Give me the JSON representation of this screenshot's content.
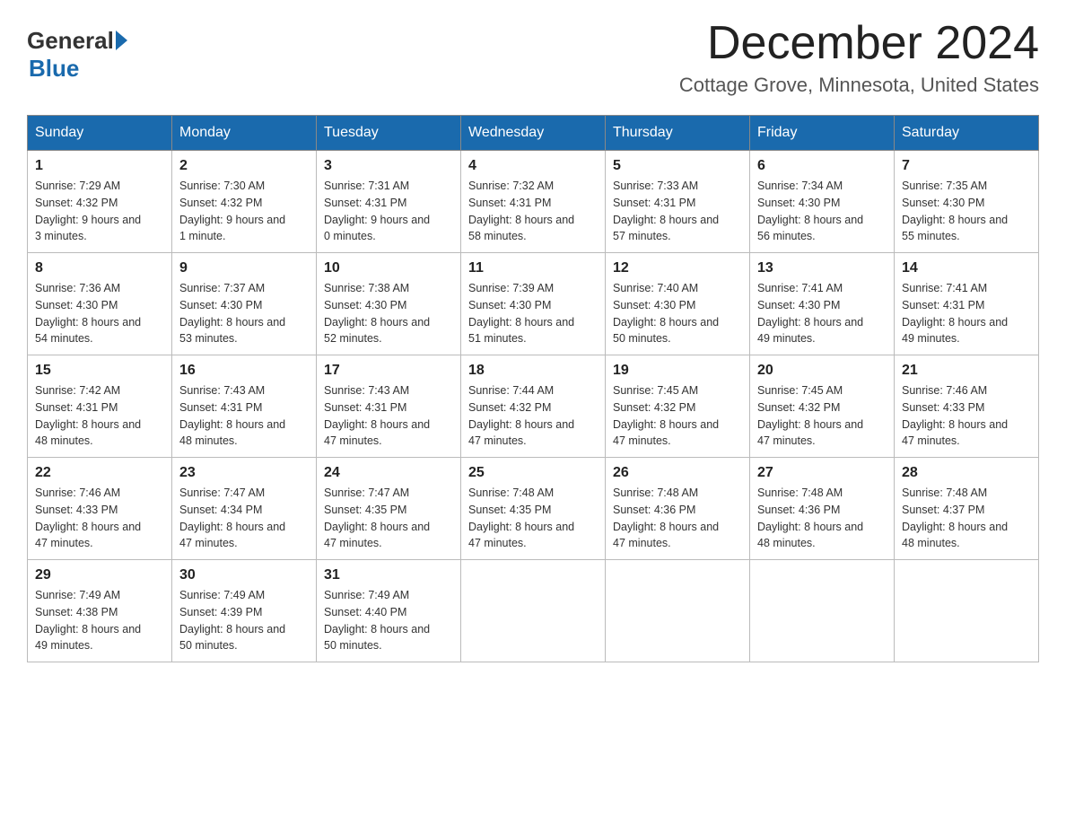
{
  "header": {
    "logo_general": "General",
    "logo_blue": "Blue",
    "month_title": "December 2024",
    "location": "Cottage Grove, Minnesota, United States"
  },
  "weekdays": [
    "Sunday",
    "Monday",
    "Tuesday",
    "Wednesday",
    "Thursday",
    "Friday",
    "Saturday"
  ],
  "weeks": [
    [
      {
        "day": "1",
        "sunrise": "7:29 AM",
        "sunset": "4:32 PM",
        "daylight": "9 hours and 3 minutes."
      },
      {
        "day": "2",
        "sunrise": "7:30 AM",
        "sunset": "4:32 PM",
        "daylight": "9 hours and 1 minute."
      },
      {
        "day": "3",
        "sunrise": "7:31 AM",
        "sunset": "4:31 PM",
        "daylight": "9 hours and 0 minutes."
      },
      {
        "day": "4",
        "sunrise": "7:32 AM",
        "sunset": "4:31 PM",
        "daylight": "8 hours and 58 minutes."
      },
      {
        "day": "5",
        "sunrise": "7:33 AM",
        "sunset": "4:31 PM",
        "daylight": "8 hours and 57 minutes."
      },
      {
        "day": "6",
        "sunrise": "7:34 AM",
        "sunset": "4:30 PM",
        "daylight": "8 hours and 56 minutes."
      },
      {
        "day": "7",
        "sunrise": "7:35 AM",
        "sunset": "4:30 PM",
        "daylight": "8 hours and 55 minutes."
      }
    ],
    [
      {
        "day": "8",
        "sunrise": "7:36 AM",
        "sunset": "4:30 PM",
        "daylight": "8 hours and 54 minutes."
      },
      {
        "day": "9",
        "sunrise": "7:37 AM",
        "sunset": "4:30 PM",
        "daylight": "8 hours and 53 minutes."
      },
      {
        "day": "10",
        "sunrise": "7:38 AM",
        "sunset": "4:30 PM",
        "daylight": "8 hours and 52 minutes."
      },
      {
        "day": "11",
        "sunrise": "7:39 AM",
        "sunset": "4:30 PM",
        "daylight": "8 hours and 51 minutes."
      },
      {
        "day": "12",
        "sunrise": "7:40 AM",
        "sunset": "4:30 PM",
        "daylight": "8 hours and 50 minutes."
      },
      {
        "day": "13",
        "sunrise": "7:41 AM",
        "sunset": "4:30 PM",
        "daylight": "8 hours and 49 minutes."
      },
      {
        "day": "14",
        "sunrise": "7:41 AM",
        "sunset": "4:31 PM",
        "daylight": "8 hours and 49 minutes."
      }
    ],
    [
      {
        "day": "15",
        "sunrise": "7:42 AM",
        "sunset": "4:31 PM",
        "daylight": "8 hours and 48 minutes."
      },
      {
        "day": "16",
        "sunrise": "7:43 AM",
        "sunset": "4:31 PM",
        "daylight": "8 hours and 48 minutes."
      },
      {
        "day": "17",
        "sunrise": "7:43 AM",
        "sunset": "4:31 PM",
        "daylight": "8 hours and 47 minutes."
      },
      {
        "day": "18",
        "sunrise": "7:44 AM",
        "sunset": "4:32 PM",
        "daylight": "8 hours and 47 minutes."
      },
      {
        "day": "19",
        "sunrise": "7:45 AM",
        "sunset": "4:32 PM",
        "daylight": "8 hours and 47 minutes."
      },
      {
        "day": "20",
        "sunrise": "7:45 AM",
        "sunset": "4:32 PM",
        "daylight": "8 hours and 47 minutes."
      },
      {
        "day": "21",
        "sunrise": "7:46 AM",
        "sunset": "4:33 PM",
        "daylight": "8 hours and 47 minutes."
      }
    ],
    [
      {
        "day": "22",
        "sunrise": "7:46 AM",
        "sunset": "4:33 PM",
        "daylight": "8 hours and 47 minutes."
      },
      {
        "day": "23",
        "sunrise": "7:47 AM",
        "sunset": "4:34 PM",
        "daylight": "8 hours and 47 minutes."
      },
      {
        "day": "24",
        "sunrise": "7:47 AM",
        "sunset": "4:35 PM",
        "daylight": "8 hours and 47 minutes."
      },
      {
        "day": "25",
        "sunrise": "7:48 AM",
        "sunset": "4:35 PM",
        "daylight": "8 hours and 47 minutes."
      },
      {
        "day": "26",
        "sunrise": "7:48 AM",
        "sunset": "4:36 PM",
        "daylight": "8 hours and 47 minutes."
      },
      {
        "day": "27",
        "sunrise": "7:48 AM",
        "sunset": "4:36 PM",
        "daylight": "8 hours and 48 minutes."
      },
      {
        "day": "28",
        "sunrise": "7:48 AM",
        "sunset": "4:37 PM",
        "daylight": "8 hours and 48 minutes."
      }
    ],
    [
      {
        "day": "29",
        "sunrise": "7:49 AM",
        "sunset": "4:38 PM",
        "daylight": "8 hours and 49 minutes."
      },
      {
        "day": "30",
        "sunrise": "7:49 AM",
        "sunset": "4:39 PM",
        "daylight": "8 hours and 50 minutes."
      },
      {
        "day": "31",
        "sunrise": "7:49 AM",
        "sunset": "4:40 PM",
        "daylight": "8 hours and 50 minutes."
      },
      null,
      null,
      null,
      null
    ]
  ],
  "labels": {
    "sunrise": "Sunrise:",
    "sunset": "Sunset:",
    "daylight": "Daylight:"
  }
}
